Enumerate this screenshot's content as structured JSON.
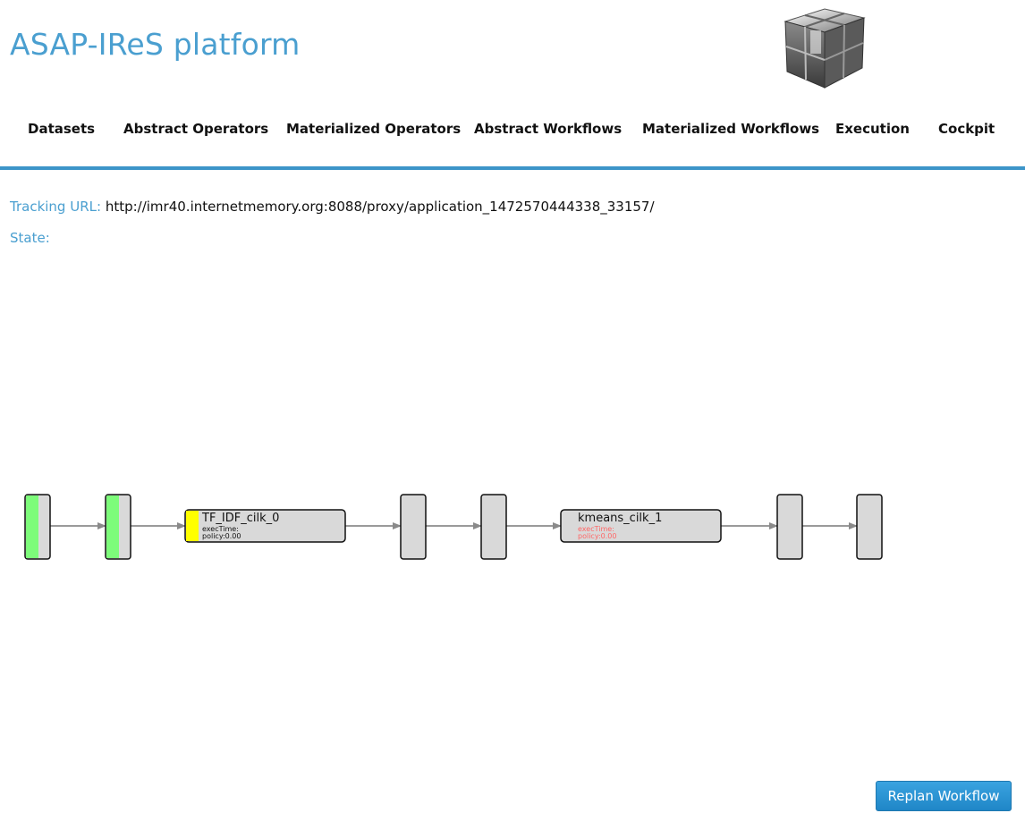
{
  "header": {
    "brand": "ASAP-IReS platform"
  },
  "nav": {
    "items": [
      {
        "label": "Datasets"
      },
      {
        "label": "Abstract Operators"
      },
      {
        "label": "Materialized Operators"
      },
      {
        "label": "Abstract Workflows"
      },
      {
        "label": "Materialized Workflows"
      },
      {
        "label": "Execution"
      },
      {
        "label": "Cockpit"
      }
    ]
  },
  "info": {
    "tracking_label": "Tracking URL:",
    "tracking_url": "http://imr40.internetmemory.org:8088/proxy/application_1472570444338_33157/",
    "state_label": "State:"
  },
  "workflow": {
    "operators": [
      {
        "name": "TF_IDF_cilk_0",
        "exec_time": "execTime:",
        "policy": "policy:0.00"
      },
      {
        "name": "kmeans_cilk_1",
        "exec_time": "execTime:",
        "policy": "policy:0.00"
      }
    ]
  },
  "actions": {
    "replan_label": "Replan Workflow"
  },
  "colors": {
    "accent": "#4a9fd0",
    "rule": "#3d95c9",
    "done": "#7dfc7a",
    "running": "#ffff00",
    "node": "#d9d9d9",
    "warn_text": "#ff6666"
  }
}
